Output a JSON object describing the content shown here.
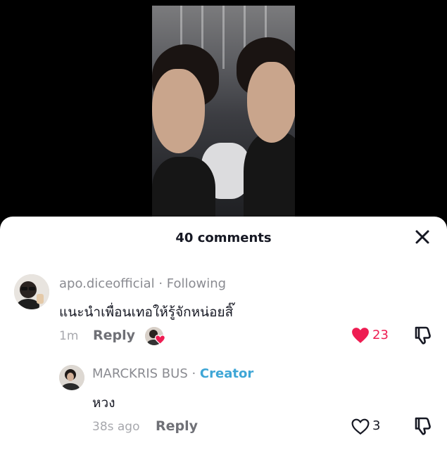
{
  "sheet": {
    "title": "40 comments"
  },
  "comments": [
    {
      "username": "apo.diceofficial",
      "relation": " · Following",
      "text": "แนะนำเพื่อนเทอให้รู้จักหน่อยสิ๊",
      "time": "1m",
      "reply_label": "Reply",
      "likes": "23",
      "liked": true
    }
  ],
  "replies": [
    {
      "username": "MARCKRIS BUS",
      "separator": " · ",
      "badge": "Creator",
      "text": "หวง",
      "time": "38s ago",
      "reply_label": "Reply",
      "likes": "3",
      "liked": false
    }
  ],
  "colors": {
    "like_red": "#ee1d52",
    "creator_blue": "#3ea6d6"
  }
}
